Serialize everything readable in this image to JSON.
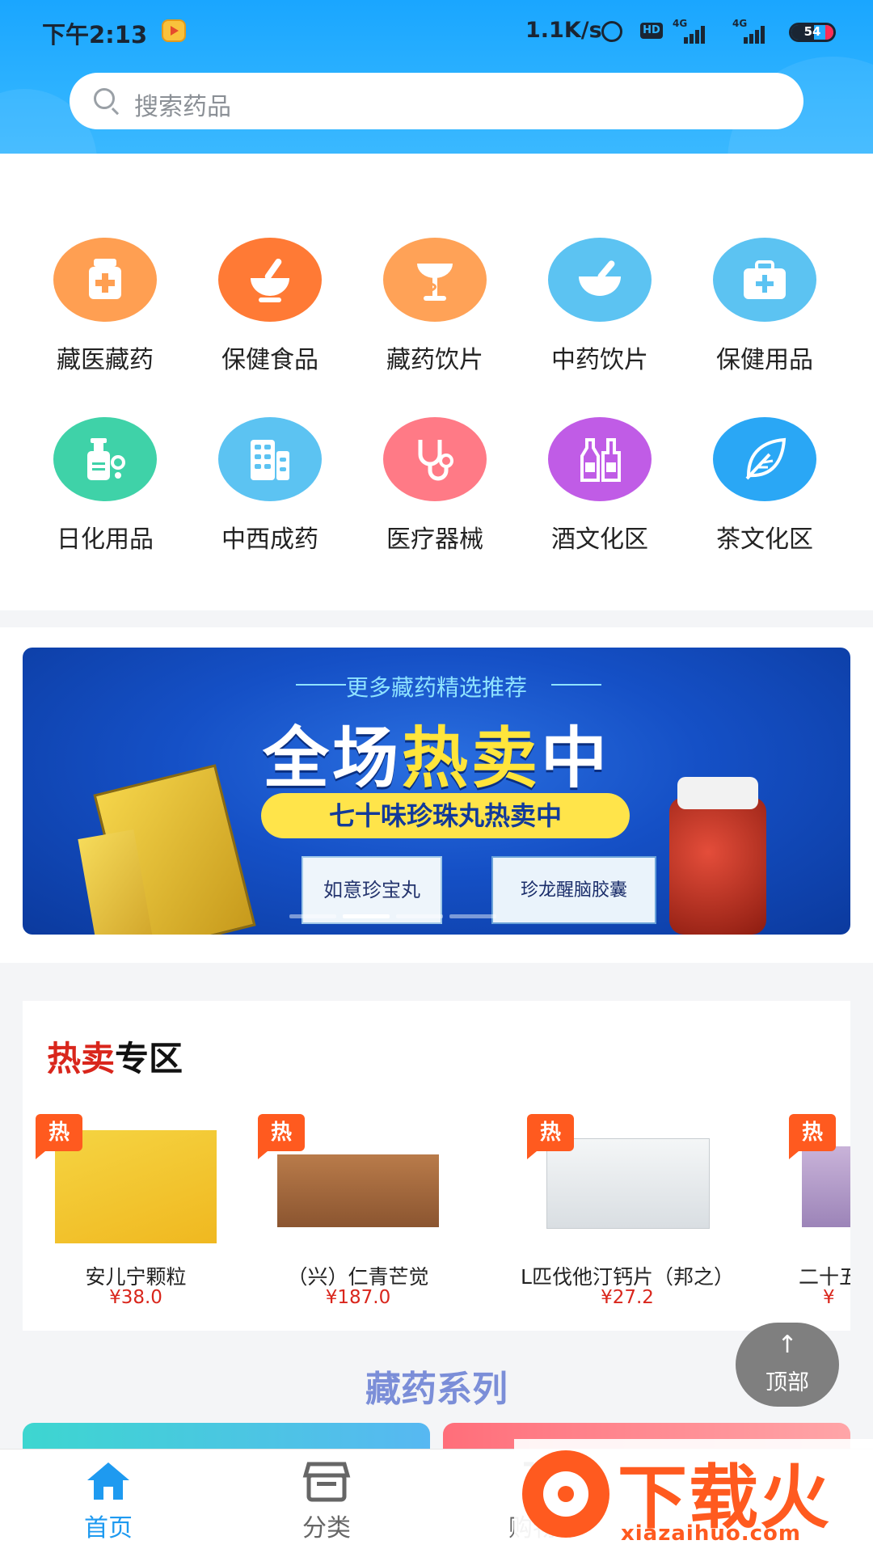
{
  "status_bar": {
    "time": "下午2:13",
    "net_speed": "1.1K/s",
    "hd": "HD",
    "signal1_label": "4G",
    "signal2_label": "4G",
    "battery": "54"
  },
  "search": {
    "placeholder": "搜索药品"
  },
  "categories": [
    {
      "label": "藏医藏药",
      "icon": "medicine-bottle-icon",
      "color": "#ff9f52"
    },
    {
      "label": "保健食品",
      "icon": "mortar-pestle-icon",
      "color": "#ff7a35"
    },
    {
      "label": "藏药饮片",
      "icon": "pharmacy-cup-icon",
      "color": "#ffa257"
    },
    {
      "label": "中药饮片",
      "icon": "herb-bowl-icon",
      "color": "#5cc3f2"
    },
    {
      "label": "保健用品",
      "icon": "first-aid-kit-icon",
      "color": "#5cc3f2"
    },
    {
      "label": "日化用品",
      "icon": "lotion-bottle-icon",
      "color": "#3fd2a8"
    },
    {
      "label": "中西成药",
      "icon": "pills-icon",
      "color": "#5cc3f2"
    },
    {
      "label": "医疗器械",
      "icon": "stethoscope-icon",
      "color": "#ff7a86"
    },
    {
      "label": "酒文化区",
      "icon": "wine-bottles-icon",
      "color": "#c05ce6"
    },
    {
      "label": "茶文化区",
      "icon": "tea-leaf-icon",
      "color": "#2aa7f5"
    }
  ],
  "banner": {
    "subtitle": "更多藏药精选推荐",
    "title_a": "全场",
    "title_hot": "热卖",
    "title_b": "中",
    "pill": "七十味珍珠丸热卖中",
    "product_labels": [
      "如意珍宝丸",
      "珍龙醒脑胶囊"
    ]
  },
  "hot_section": {
    "title_red": "热卖",
    "title_rest": "专区",
    "tag": "热",
    "products": [
      {
        "name": "安儿宁颗粒",
        "price": "¥38.0"
      },
      {
        "name": "（兴）仁青芒觉",
        "price": "¥187.0"
      },
      {
        "name": "L匹伐他汀钙片（邦之）",
        "price": "¥27.2"
      },
      {
        "name": "二十五",
        "price": "¥"
      }
    ]
  },
  "series_title": "藏药系列",
  "back_to_top": "顶部",
  "tabs": [
    {
      "label": "首页",
      "active": true
    },
    {
      "label": "分类",
      "active": false
    },
    {
      "label": "购物车",
      "active": false
    }
  ],
  "watermark": {
    "text": "下载火",
    "url": "xiazaihuo.com"
  },
  "colors": {
    "accent": "#2db2ff",
    "tab_active": "#1e9af0",
    "price_red": "#d9261c"
  }
}
